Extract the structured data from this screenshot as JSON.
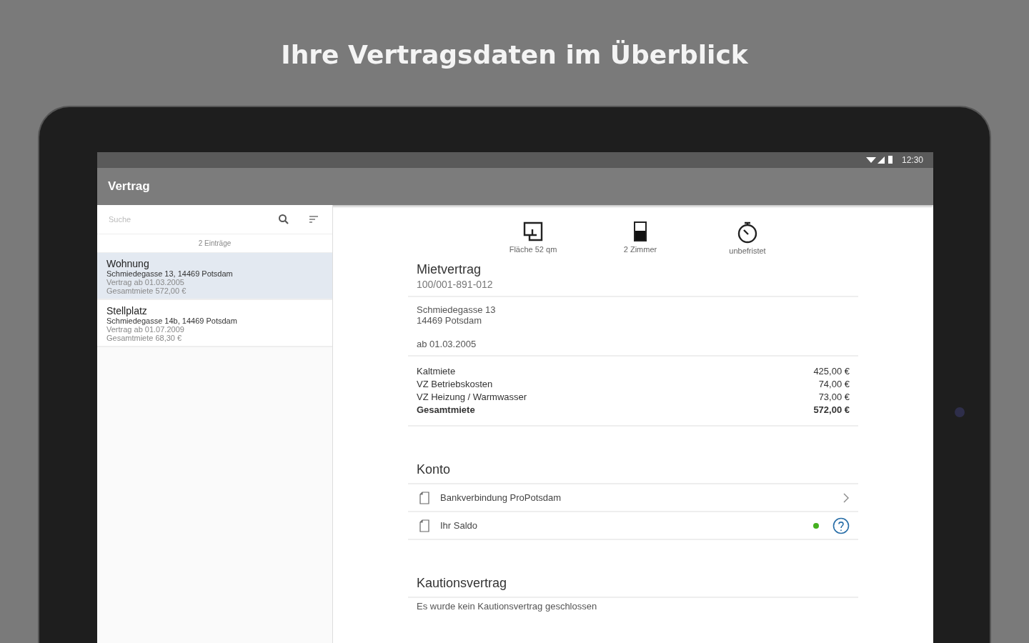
{
  "headline": "Ihre Vertragsdaten im Überblick",
  "status_bar": {
    "time": "12:30"
  },
  "app_bar": {
    "title": "Vertrag"
  },
  "sidebar": {
    "search": {
      "placeholder": "Suche"
    },
    "count": "2 Einträge",
    "items": [
      {
        "title": "Wohnung",
        "address": "Schmiedegasse 13, 14469 Potsdam",
        "contract": "Vertrag ab 01.03.2005",
        "total": "Gesamtmiete 572,00 €",
        "selected": true
      },
      {
        "title": "Stellplatz",
        "address": "Schmiedegasse 14b, 14469 Potsdam",
        "contract": "Vertrag ab 01.07.2009",
        "total": "Gesamtmiete 68,30 €",
        "selected": false
      }
    ]
  },
  "detail": {
    "features": [
      {
        "kind": "area",
        "label": "Fläche 52 qm"
      },
      {
        "kind": "rooms",
        "label": "2 Zimmer"
      },
      {
        "kind": "term",
        "label": "unbefristet"
      }
    ],
    "contract": {
      "title": "Mietvertrag",
      "number": "100/001-891-012",
      "address_lines": [
        "Schmiedegasse 13",
        "14469 Potsdam"
      ],
      "start": "ab 01.03.2005",
      "costs": [
        {
          "label": "Kaltmiete",
          "amount": "425,00 €",
          "total": false
        },
        {
          "label": "VZ Betriebskosten",
          "amount": "74,00 €",
          "total": false
        },
        {
          "label": "VZ Heizung / Warmwasser",
          "amount": "73,00 €",
          "total": false
        },
        {
          "label": "Gesamtmiete",
          "amount": "572,00 €",
          "total": true
        }
      ]
    },
    "account": {
      "title": "Konto",
      "items": [
        {
          "label": "Bankverbindung ProPotsdam",
          "kind": "link"
        },
        {
          "label": "Ihr Saldo",
          "kind": "status",
          "color": "#44b020"
        }
      ]
    },
    "deposit": {
      "title": "Kautionsvertrag",
      "text": "Es wurde kein Kautionsvertrag geschlossen"
    }
  }
}
